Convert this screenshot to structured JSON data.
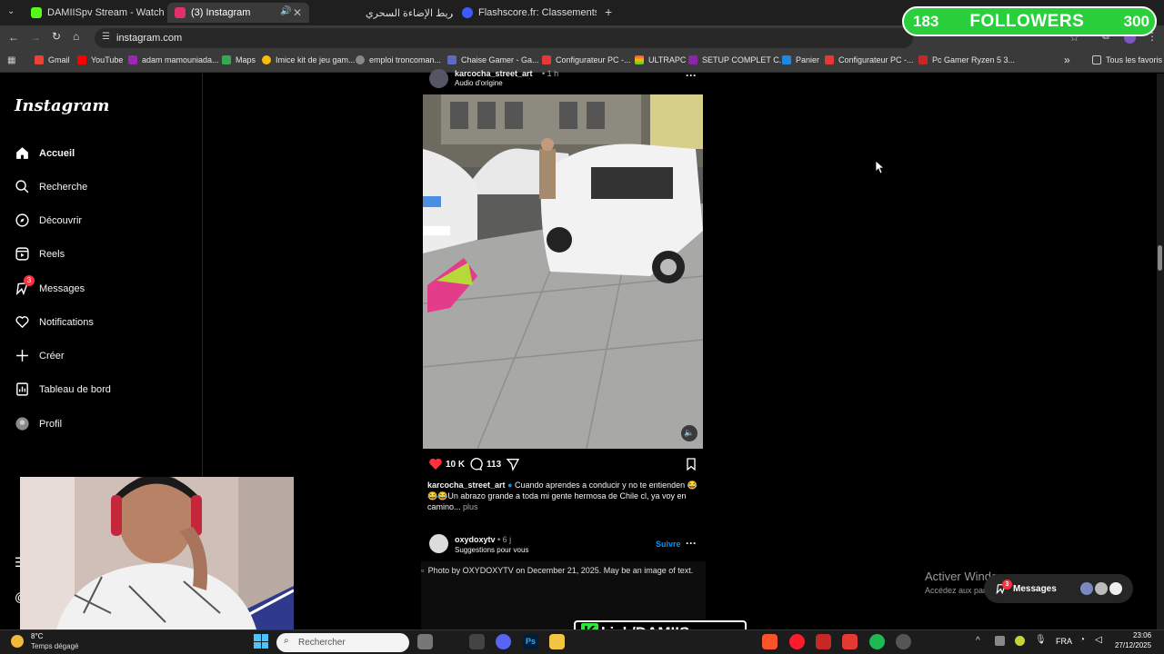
{
  "browser": {
    "tabs": [
      {
        "label": "DAMIISpv Stream - Watch Live",
        "color": "#53fc18"
      },
      {
        "label": "(3) Instagram",
        "color": "#e1306c"
      },
      {
        "label": "شريط الإضاءة السحري",
        "color": "#ff0000",
        "muted": true
      },
      {
        "label": "Flashscore.fr: Classements de C",
        "color": "#3d5afe"
      }
    ],
    "url": "instagram.com",
    "bookmarks": [
      "Gmail",
      "YouTube",
      "adam mamouniada...",
      "Maps",
      "Imice kit de jeu gam...",
      "emploi troncoman...",
      "Chaise Gamer - Ga...",
      "Configurateur PC -...",
      "ULTRAPC",
      "SETUP COMPLET C...",
      "Panier",
      "Configurateur PC -...",
      "Pc Gamer Ryzen 5 3...",
      "»",
      "Tous les favoris"
    ]
  },
  "overlay": {
    "followers_count": "183",
    "followers_label": "FOLLOWERS",
    "followers_goal": "300",
    "kick_prefix": "K",
    "kick_handle": "kick/DAMIISpv"
  },
  "sidebar": {
    "logo": "Instagram",
    "items": [
      {
        "label": "Accueil",
        "icon": "home-icon"
      },
      {
        "label": "Recherche",
        "icon": "search-icon"
      },
      {
        "label": "Découvrir",
        "icon": "compass-icon"
      },
      {
        "label": "Reels",
        "icon": "reels-icon"
      },
      {
        "label": "Messages",
        "icon": "messenger-icon",
        "badge": "3"
      },
      {
        "label": "Notifications",
        "icon": "heart-icon"
      },
      {
        "label": "Créer",
        "icon": "plus-icon"
      },
      {
        "label": "Tableau de bord",
        "icon": "dashboard-icon"
      },
      {
        "label": "Profil",
        "icon": "avatar-icon"
      }
    ]
  },
  "post1": {
    "username": "karcocha_street_art",
    "time": "• 1 h",
    "audio": "Audio d'origine",
    "likes": "10 K",
    "comments": "113",
    "caption_user": "karcocha_street_art",
    "caption_text": "Cuando aprendes a conducir y no te entienden 😂😂😂Un abrazo grande a toda mi gente hermosa de Chile cl, ya voy en camino...",
    "more": "plus"
  },
  "post2": {
    "username": "oxydoxytv",
    "time": "• 6 j",
    "subtitle": "Suggestions pour vous",
    "follow": "Suivre",
    "image_alt": "Photo by OXYDOXYTV on December 21, 2025. May be an image of text."
  },
  "windows": {
    "activate_title": "Activer Windows",
    "activate_sub": "Accédez aux paramètres pour activer Windows.",
    "messages_label": "Messages",
    "messages_badge": "3"
  },
  "taskbar": {
    "weather_temp": "8°C",
    "weather_desc": "Temps dégagé",
    "search_placeholder": "Rechercher",
    "lang": "FRA",
    "time": "23:06",
    "date": "27/12/2025"
  }
}
